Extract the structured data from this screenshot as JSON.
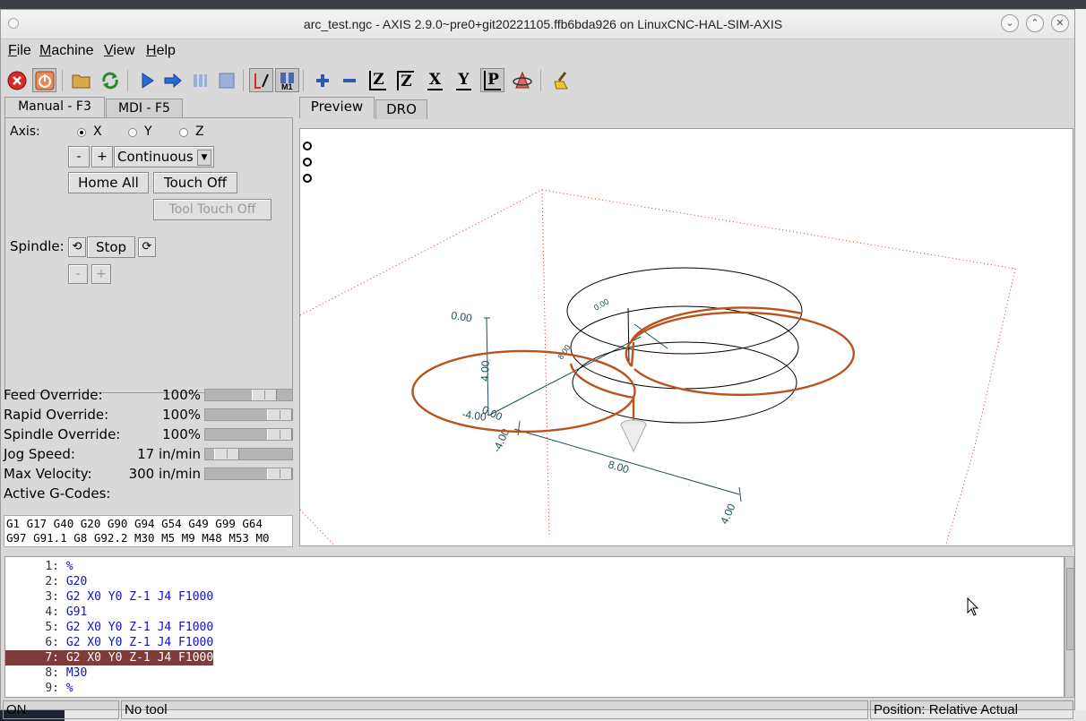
{
  "window": {
    "title": "arc_test.ngc - AXIS 2.9.0~pre0+git20221105.ffb6bda926 on LinuxCNC-HAL-SIM-AXIS"
  },
  "menu": [
    {
      "label": "File",
      "key": "F",
      "rest": "ile"
    },
    {
      "label": "Machine",
      "key": "M",
      "rest": "achine"
    },
    {
      "label": "View",
      "key": "V",
      "rest": "iew"
    },
    {
      "label": "Help",
      "key": "H",
      "rest": "elp"
    }
  ],
  "left_tabs": [
    "Manual - F3",
    "MDI - F5"
  ],
  "right_tabs": [
    "Preview",
    "DRO"
  ],
  "manual": {
    "axis_label": "Axis:",
    "axes": [
      "X",
      "Y",
      "Z"
    ],
    "selected_axis": "X",
    "jog_minus": "-",
    "jog_plus": "+",
    "jog_mode": "Continuous",
    "home_all": "Home All",
    "touch_off": "Touch Off",
    "tool_touch_off": "Tool Touch Off",
    "spindle_label": "Spindle:",
    "spindle_stop": "Stop",
    "spindle_minus": "-",
    "spindle_plus": "+"
  },
  "overrides": [
    {
      "label": "Feed Override:",
      "value": "100%",
      "level": 0.75
    },
    {
      "label": "Rapid Override:",
      "value": "100%",
      "level": 1.0
    },
    {
      "label": "Spindle Override:",
      "value": "100%",
      "level": 1.0
    },
    {
      "label": "Jog Speed:",
      "value": "17 in/min",
      "level": 0.15
    },
    {
      "label": "Max Velocity:",
      "value": "300 in/min",
      "level": 1.0
    }
  ],
  "active_gcodes_label": "Active G-Codes:",
  "active_gcodes": [
    "G1 G17 G40 G20 G90 G94 G54 G49 G99 G64",
    "G97 G91.1 G8 G92.2 M30 M5 M9 M48 M53 M0"
  ],
  "preview": {
    "axis_labels": [
      "0.00",
      "4.00",
      "0.00",
      "-4.00",
      "-4.00",
      "8.00",
      "4.00",
      "0.00",
      "8.00"
    ]
  },
  "code_lines": [
    {
      "num": "1:",
      "text": "%"
    },
    {
      "num": "2:",
      "text": "G20"
    },
    {
      "num": "3:",
      "text": "G2 X0 Y0 Z-1 J4 F1000"
    },
    {
      "num": "4:",
      "text": "G91"
    },
    {
      "num": "5:",
      "text": "G2 X0 Y0 Z-1 J4 F1000"
    },
    {
      "num": "6:",
      "text": "G2 X0 Y0 Z-1 J4 F1000"
    },
    {
      "num": "7:",
      "text": "G2 X0 Y0 Z-1 J4 F1000"
    },
    {
      "num": "8:",
      "text": "M30"
    },
    {
      "num": "9:",
      "text": "%"
    }
  ],
  "selected_line": 7,
  "status": {
    "machine": "ON",
    "tool": "No tool",
    "position": "Position: Relative Actual"
  },
  "colors": {
    "toolpath": "#b9531c",
    "selected_line": "#7f3a3a",
    "gcode_text": "#1010c8",
    "grid": "#e03030",
    "axes": "#1f4f55"
  },
  "toolbar_icons": [
    "estop-icon",
    "power-icon",
    "open-file-icon",
    "reload-icon",
    "run-icon",
    "step-icon",
    "pause-icon",
    "stop-icon",
    "block-delete-icon",
    "optional-stop-icon",
    "zoom-in-icon",
    "zoom-out-icon",
    "view-z-icon",
    "view-rotated-z-icon",
    "view-x-icon",
    "view-y-icon",
    "view-perspective-icon",
    "rotate-view-icon",
    "clear-plot-icon"
  ]
}
